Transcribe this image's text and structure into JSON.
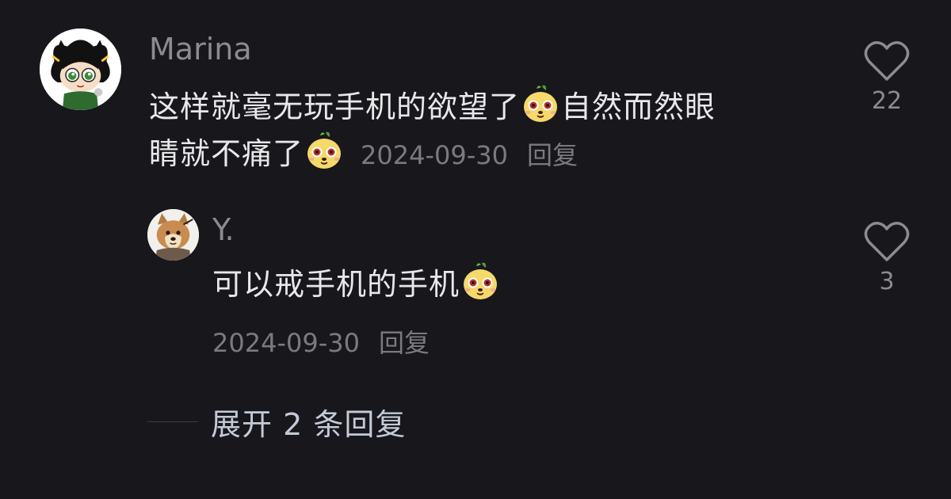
{
  "comment": {
    "username": "Marina",
    "text_parts": [
      "这样就毫无玩手机的欲望了",
      "自然而然眼",
      "睛就不痛了"
    ],
    "emoji_icon": "cute-mole-emoji-icon",
    "date": "2024-09-30",
    "reply_label": "回复",
    "likes": "22"
  },
  "reply": {
    "username": "Y.",
    "text": "可以戒手机的手机",
    "emoji_icon": "cute-mole-emoji-icon",
    "date": "2024-09-30",
    "reply_label": "回复",
    "likes": "3"
  },
  "expand_label": "展开 2 条回复",
  "colors": {
    "background": "#17171c",
    "text": "#e8e8ea",
    "muted": "#7a7a80",
    "expand": "#c4cad6"
  }
}
